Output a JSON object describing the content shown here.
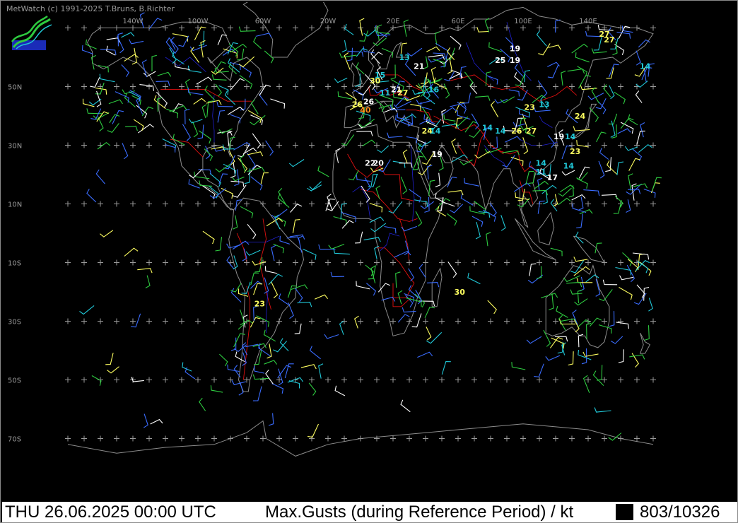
{
  "header": {
    "copyright": "MetWatch  (c) 1991-2025 T.Bruns, B.Richter"
  },
  "status": {
    "datetime": "THU 26.06.2025 00:00 UTC",
    "title": "Max.Gusts (during Reference Period) / kt",
    "count": "803/10326"
  },
  "map": {
    "lon_labels": [
      "140W",
      "100W",
      "60W",
      "20W",
      "20E",
      "60E",
      "100E",
      "140E"
    ],
    "lat_labels": [
      "50N",
      "30N",
      "10N",
      "10S",
      "30S",
      "50S",
      "70S"
    ],
    "colors": {
      "background": "#000000",
      "coastline": "#8c8c8c",
      "borders": "#e01010",
      "rivers": "#2020d0",
      "grid_cross": "#9a9a9a",
      "barb_blue": "#3a6cff",
      "barb_green": "#2ecc40",
      "barb_cyan": "#20c8d8",
      "barb_white": "#ffffff",
      "barb_yellow": "#ffff60",
      "barb_orange": "#ff8c1a"
    },
    "gust_values": [
      {
        "text": "27",
        "color": "#ffff60",
        "lon": 150,
        "lat": 68
      },
      {
        "text": "27",
        "color": "#ffff60",
        "lon": 153,
        "lat": 66
      },
      {
        "text": "19",
        "color": "#ffffff",
        "lon": 95,
        "lat": 63
      },
      {
        "text": "25",
        "color": "#ffffff",
        "lon": 86,
        "lat": 59
      },
      {
        "text": "19",
        "color": "#ffffff",
        "lon": 95,
        "lat": 59
      },
      {
        "text": "13",
        "color": "#20c8d8",
        "lon": 27,
        "lat": 60
      },
      {
        "text": "21",
        "color": "#ffffff",
        "lon": 36,
        "lat": 57
      },
      {
        "text": "14",
        "color": "#20c8d8",
        "lon": 175,
        "lat": 57
      },
      {
        "text": "15",
        "color": "#20c8d8",
        "lon": 12,
        "lat": 54
      },
      {
        "text": "30",
        "color": "#ffff60",
        "lon": 9,
        "lat": 52
      },
      {
        "text": "21",
        "color": "#ffffff",
        "lon": 22,
        "lat": 49
      },
      {
        "text": "11",
        "color": "#20c8d8",
        "lon": 15,
        "lat": 48
      },
      {
        "text": "27",
        "color": "#ffff60",
        "lon": 26,
        "lat": 48
      },
      {
        "text": "16",
        "color": "#20c8d8",
        "lon": 45,
        "lat": 49
      },
      {
        "text": "26",
        "color": "#ffffff",
        "lon": 5,
        "lat": 45
      },
      {
        "text": "26",
        "color": "#ffff60",
        "lon": -2,
        "lat": 44
      },
      {
        "text": "40",
        "color": "#ff8c1a",
        "lon": 3,
        "lat": 42
      },
      {
        "text": "23",
        "color": "#ffff60",
        "lon": 104,
        "lat": 43
      },
      {
        "text": "13",
        "color": "#20c8d8",
        "lon": 113,
        "lat": 44
      },
      {
        "text": "24",
        "color": "#ffff60",
        "lon": 135,
        "lat": 40
      },
      {
        "text": "24",
        "color": "#ffff60",
        "lon": 41,
        "lat": 35
      },
      {
        "text": "14",
        "color": "#20c8d8",
        "lon": 46,
        "lat": 35
      },
      {
        "text": "14",
        "color": "#20c8d8",
        "lon": 78,
        "lat": 36
      },
      {
        "text": "14",
        "color": "#20c8d8",
        "lon": 86,
        "lat": 35
      },
      {
        "text": "26",
        "color": "#ffff60",
        "lon": 96,
        "lat": 35
      },
      {
        "text": "27",
        "color": "#ffff60",
        "lon": 105,
        "lat": 35
      },
      {
        "text": "19",
        "color": "#ffffff",
        "lon": 122,
        "lat": 33
      },
      {
        "text": "14",
        "color": "#20c8d8",
        "lon": 129,
        "lat": 33
      },
      {
        "text": "19",
        "color": "#ffffff",
        "lon": 47,
        "lat": 27
      },
      {
        "text": "23",
        "color": "#ffff60",
        "lon": 132,
        "lat": 28
      },
      {
        "text": "22",
        "color": "#ffffff",
        "lon": 6,
        "lat": 24
      },
      {
        "text": "20",
        "color": "#ffffff",
        "lon": 11,
        "lat": 24
      },
      {
        "text": "14",
        "color": "#20c8d8",
        "lon": 111,
        "lat": 24
      },
      {
        "text": "14",
        "color": "#20c8d8",
        "lon": 128,
        "lat": 23
      },
      {
        "text": "11",
        "color": "#20c8d8",
        "lon": 111,
        "lat": 21
      },
      {
        "text": "17",
        "color": "#ffffff",
        "lon": 118,
        "lat": 19
      },
      {
        "text": "30",
        "color": "#ffff60",
        "lon": 61,
        "lat": -20
      },
      {
        "text": "23",
        "color": "#ffff60",
        "lon": -62,
        "lat": -24
      }
    ]
  }
}
